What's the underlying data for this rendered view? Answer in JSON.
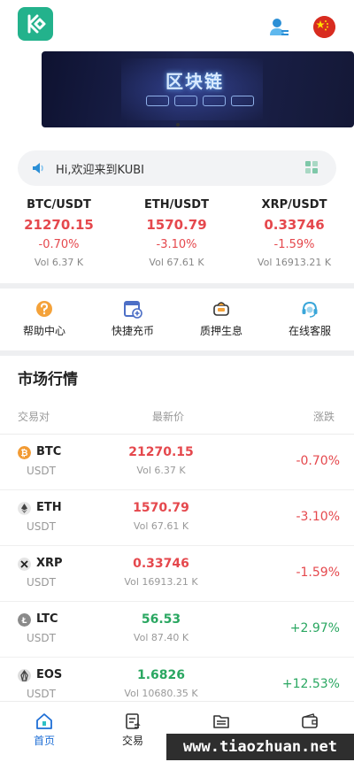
{
  "header": {
    "logo_icon": "kucoin-logo-icon",
    "user_icon": "user-profile-icon",
    "flag_icon": "china-flag-icon"
  },
  "banner": {
    "title": "区块链",
    "pills": [
      "",
      "",
      "",
      ""
    ]
  },
  "notice": {
    "text": "Hi,欢迎来到KUBI",
    "icon": "speaker-icon",
    "grid_icon": "grid-icon"
  },
  "tickers": [
    {
      "pair": "BTC/USDT",
      "price": "21270.15",
      "change": "-0.70%",
      "vol": "Vol 6.37 K"
    },
    {
      "pair": "ETH/USDT",
      "price": "1570.79",
      "change": "-3.10%",
      "vol": "Vol 67.61 K"
    },
    {
      "pair": "XRP/USDT",
      "price": "0.33746",
      "change": "-1.59%",
      "vol": "Vol 16913.21 K"
    }
  ],
  "quick_menu": [
    {
      "label": "帮助中心",
      "icon": "help-icon"
    },
    {
      "label": "快捷充币",
      "icon": "deposit-icon"
    },
    {
      "label": "质押生息",
      "icon": "staking-icon"
    },
    {
      "label": "在线客服",
      "icon": "support-icon"
    }
  ],
  "market": {
    "title": "市场行情",
    "columns": [
      "交易对",
      "最新价",
      "涨跌"
    ],
    "rows": [
      {
        "symbol": "BTC",
        "quote": "USDT",
        "price": "21270.15",
        "vol": "Vol 6.37 K",
        "change": "-0.70%",
        "trend": "down",
        "icon_color": "#f29b34"
      },
      {
        "symbol": "ETH",
        "quote": "USDT",
        "price": "1570.79",
        "vol": "Vol 67.61 K",
        "change": "-3.10%",
        "trend": "down",
        "icon_color": "#6b6b6b"
      },
      {
        "symbol": "XRP",
        "quote": "USDT",
        "price": "0.33746",
        "vol": "Vol 16913.21 K",
        "change": "-1.59%",
        "trend": "down",
        "icon_color": "#2b2b2b"
      },
      {
        "symbol": "LTC",
        "quote": "USDT",
        "price": "56.53",
        "vol": "Vol 87.40 K",
        "change": "+2.97%",
        "trend": "up",
        "icon_color": "#8a8a8a"
      },
      {
        "symbol": "EOS",
        "quote": "USDT",
        "price": "1.6826",
        "vol": "Vol 10680.35 K",
        "change": "+12.53%",
        "trend": "up",
        "icon_color": "#5a5a5a"
      }
    ]
  },
  "bottom_nav": [
    {
      "label": "首页",
      "icon": "home-icon",
      "active": true
    },
    {
      "label": "交易",
      "icon": "trade-icon",
      "active": false
    },
    {
      "label": "",
      "icon": "assets-icon",
      "active": false
    },
    {
      "label": "",
      "icon": "wallet-icon",
      "active": false
    }
  ],
  "watermark": "www.tiaozhuan.net",
  "colors": {
    "brand": "#23b28c",
    "down": "#e5484d",
    "up": "#2aa761",
    "active": "#1f6fd6"
  }
}
